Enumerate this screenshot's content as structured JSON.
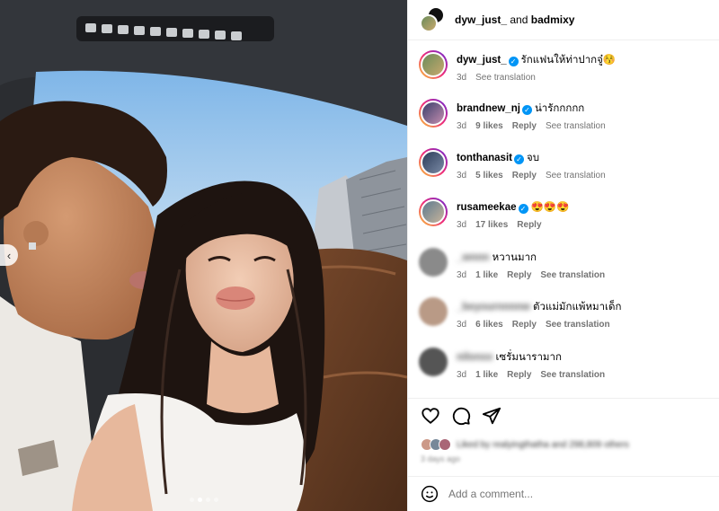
{
  "header": {
    "user1": "dyw_just_",
    "and_text": " and ",
    "user2": "badmixy"
  },
  "comments": [
    {
      "user": "dyw_just_",
      "verified": true,
      "text": "รักแฟนให้ท่าปากจู๋😚",
      "time": "3d",
      "likes": "",
      "reply": "",
      "translate": "See translation"
    },
    {
      "user": "brandnew_nj",
      "verified": true,
      "text": "น่ารักกกกก",
      "time": "3d",
      "likes": "9 likes",
      "reply": "Reply",
      "translate": "See translation"
    },
    {
      "user": "tonthanasit",
      "verified": true,
      "text": "จบ",
      "time": "3d",
      "likes": "5 likes",
      "reply": "Reply",
      "translate": "See translation"
    },
    {
      "user": "rusameekae",
      "verified": true,
      "text": "😍😍😍",
      "time": "3d",
      "likes": "17 likes",
      "reply": "Reply",
      "translate": ""
    },
    {
      "user": "_wnnn",
      "verified": false,
      "text": "หวานมาก",
      "time": "3d",
      "likes": "1 like",
      "reply": "Reply",
      "translate": "See translation"
    },
    {
      "user": "_beyournnnnw",
      "verified": false,
      "text": "ตัวแม่มักแพ้หมาเด็ก",
      "time": "3d",
      "likes": "6 likes",
      "reply": "Reply",
      "translate": "See translation"
    },
    {
      "user": "nilonxx",
      "verified": false,
      "text": "เซรั่มนารามาก",
      "time": "3d",
      "likes": "1 like",
      "reply": "Reply",
      "translate": "See translation"
    }
  ],
  "actions": {
    "liked_by": "Liked by realyingthatha and 298,809 others",
    "ago": "3 days ago"
  },
  "comment_box": {
    "placeholder": "Add a comment..."
  },
  "colors": {
    "verified": "#0095f6",
    "meta": "#737373",
    "divider": "#efefef"
  },
  "icons": [
    "chevron-left-icon",
    "heart-icon",
    "comment-icon",
    "share-icon",
    "emoji-icon",
    "verified-icon"
  ]
}
